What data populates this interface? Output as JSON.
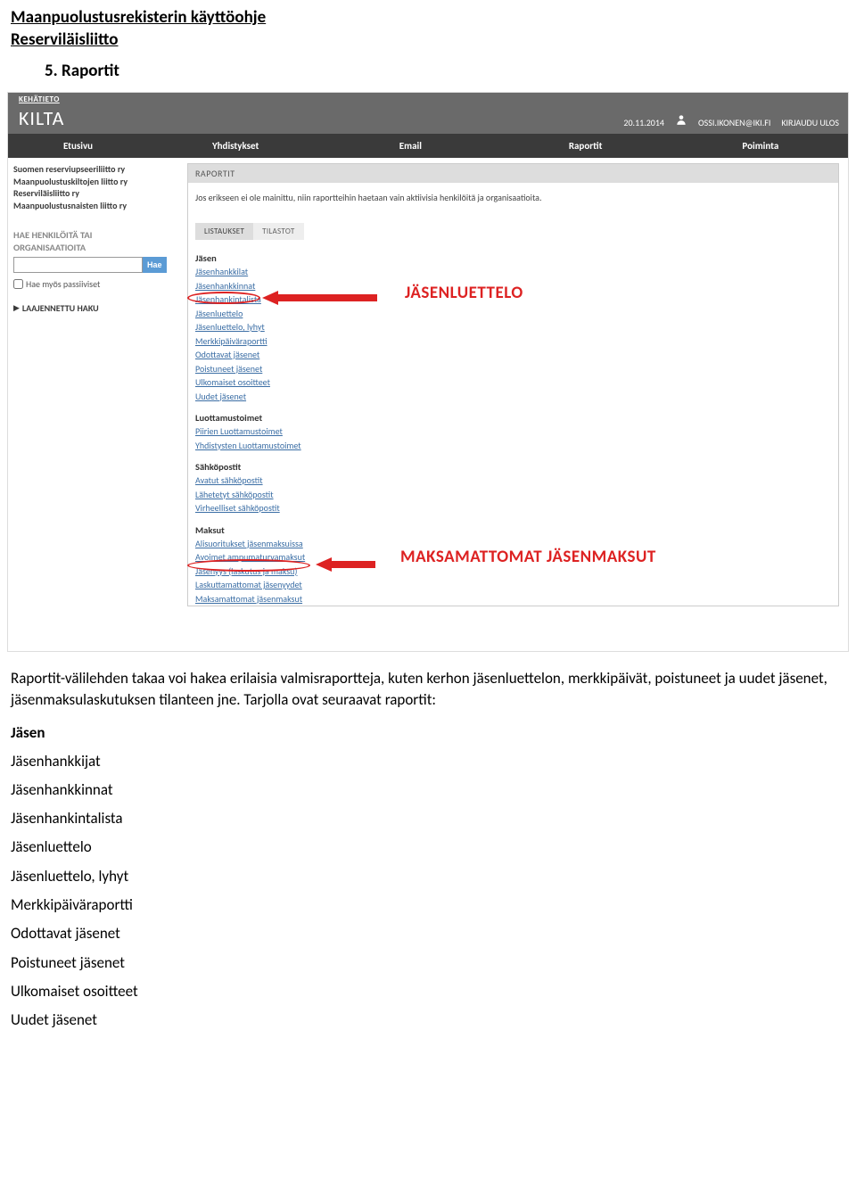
{
  "doc": {
    "title": "Maanpuolustusrekisterin käyttöohje",
    "subtitle": "Reserviläisliitto",
    "section": "5. Raportit"
  },
  "header": {
    "kehatieto": "KEHÄTIETO",
    "kilta": "KILTA",
    "date": "20.11.2014",
    "user": "OSSI.IKONEN@IKI.FI",
    "logout": "KIRJAUDU ULOS"
  },
  "nav": {
    "etusivu": "Etusivu",
    "yhdistykset": "Yhdistykset",
    "email": "Email",
    "raportit": "Raportit",
    "poiminta": "Poiminta"
  },
  "sidebar": {
    "org1": "Suomen reserviupseeriliitto ry",
    "org2": "Maanpuolustuskiltojen liitto ry",
    "org3": "Reserviläisliitto ry",
    "org4": "Maanpuolustusnaisten liitto ry",
    "hae_title1": "HAE HENKILÖITÄ TAI",
    "hae_title2": "ORGANISAATIOITA",
    "hae_btn": "Hae",
    "passive_label": "Hae myös passiiviset",
    "laajennettu": "LAAJENNETTU HAKU"
  },
  "panel": {
    "title": "RAPORTIT",
    "desc": "Jos erikseen ei ole mainittu, niin raportteihin haetaan vain aktiivisia henkilöitä ja organisaatioita.",
    "tab1": "LISTAUKSET",
    "tab2": "TILASTOT"
  },
  "lists": {
    "jasen_h": "Jäsen",
    "jasen": {
      "0": "Jäsenhankkilat",
      "1": "Jäsenhankkinnat",
      "2": "Jäsenhankintalista",
      "3": "Jäsenluettelo",
      "4": "Jäsenluettelo, lyhyt",
      "5": "Merkkipäiväraportti",
      "6": "Odottavat jäsenet",
      "7": "Poistuneet jäsenet",
      "8": "Ulkomaiset osoitteet",
      "9": "Uudet jäsenet"
    },
    "luott_h": "Luottamustoimet",
    "luott": {
      "0": "Piirien Luottamustoimet",
      "1": "Yhdistysten Luottamustoimet"
    },
    "sahko_h": "Sähköpostit",
    "sahko": {
      "0": "Avatut sähköpostit",
      "1": "Lähetetyt sähköpostit",
      "2": "Virheelliset sähköpostit"
    },
    "maksut_h": "Maksut",
    "maksut": {
      "0": "Alisuoritukset jäsenmaksuissa",
      "1": "Avoimet ampumaturvamaksut",
      "2": "Jäsenyys (laskutus ja maksu)",
      "3": "Laskuttamattomat jäsenyydet",
      "4": "Maksamattomat jäsenmaksut"
    }
  },
  "annotation": {
    "a1": "JÄSENLUETTELO",
    "a2": "MAKSAMATTOMAT JÄSENMAKSUT"
  },
  "body": {
    "para": "Raportit-välilehden takaa voi hakea erilaisia valmisraportteja, kuten kerhon jäsenluettelon, merkkipäivät, poistuneet ja uudet jäsenet, jäsenmaksulaskutuksen tilanteen jne. Tarjolla ovat seuraavat raportit:",
    "jasen_h": "Jäsen",
    "items": {
      "0": "Jäsenhankkijat",
      "1": "Jäsenhankkinnat",
      "2": "Jäsenhankintalista",
      "3": "Jäsenluettelo",
      "4": "Jäsenluettelo, lyhyt",
      "5": "Merkkipäiväraportti",
      "6": "Odottavat jäsenet",
      "7": "Poistuneet jäsenet",
      "8": "Ulkomaiset osoitteet",
      "9": "Uudet jäsenet"
    }
  }
}
